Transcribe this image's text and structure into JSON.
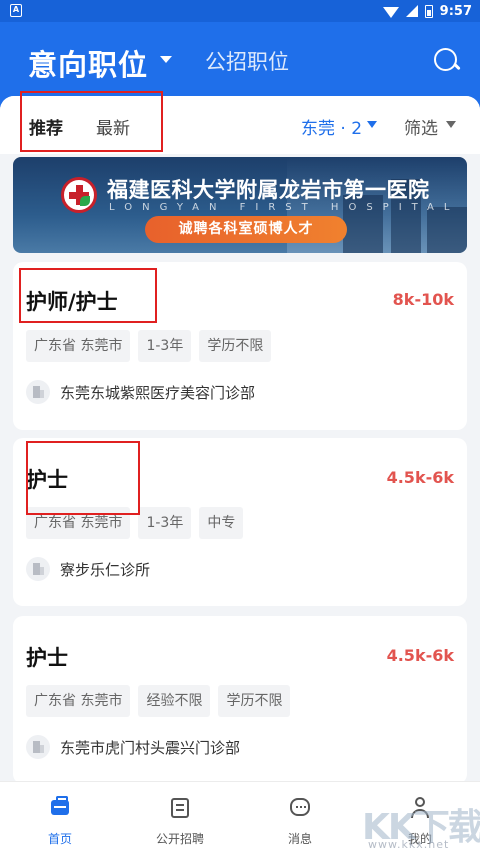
{
  "status_bar": {
    "app_icon_letter": "A",
    "time": "9:57"
  },
  "header": {
    "tab_primary": "意向职位",
    "tab_secondary": "公招职位",
    "search_icon": "search-icon"
  },
  "filter_bar": {
    "tab_recommend": "推荐",
    "tab_latest": "最新",
    "city": "东莞 · 2",
    "filter": "筛选"
  },
  "banner": {
    "title": "福建医科大学附属龙岩市第一医院",
    "subtitle": "LONGYAN FIRST HOSPITAL",
    "cta": "诚聘各科室硕博人才"
  },
  "jobs": [
    {
      "title": "护师/护士",
      "salary": "8k-10k",
      "tags": [
        "广东省 东莞市",
        "1-3年",
        "学历不限"
      ],
      "company": "东莞东城紫熙医疗美容门诊部"
    },
    {
      "title": "护士",
      "salary": "4.5k-6k",
      "tags": [
        "广东省 东莞市",
        "1-3年",
        "中专"
      ],
      "company": "寮步乐仁诊所"
    },
    {
      "title": "护士",
      "salary": "4.5k-6k",
      "tags": [
        "广东省 东莞市",
        "经验不限",
        "学历不限"
      ],
      "company": "东莞市虎门村头震兴门诊部"
    }
  ],
  "tab_bar": [
    {
      "label": "首页",
      "icon": "briefcase-icon",
      "active": true
    },
    {
      "label": "公开招聘",
      "icon": "document-icon",
      "active": false
    },
    {
      "label": "消息",
      "icon": "message-icon",
      "active": false
    },
    {
      "label": "我的",
      "icon": "user-icon",
      "active": false
    }
  ],
  "watermark": {
    "text": "KK下载",
    "url": "www.kkx.net"
  },
  "colors": {
    "primary": "#1f6fea",
    "salary": "#e2544f",
    "annotation_box": "#e02020",
    "banner_cta": "#f0812e"
  }
}
